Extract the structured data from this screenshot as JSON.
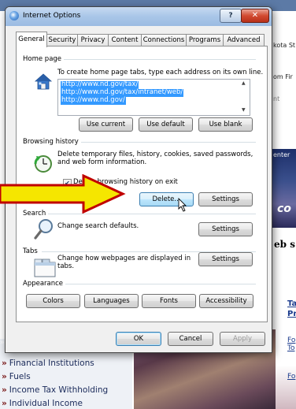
{
  "background": {
    "header_fragments": [
      "kota St",
      "om Fir",
      "nt"
    ],
    "banner_text": "enter",
    "banner_big": "co",
    "web_heading": "eb s",
    "links_right": [
      "Ta",
      "Pr",
      "Fo",
      "To",
      "Fo"
    ],
    "nav_items": [
      "Financial Institutions",
      "Fuels",
      "Income Tax Withholding",
      "Individual Income"
    ]
  },
  "dialog": {
    "title": "Internet Options",
    "help_label": "?",
    "close_label": "✕",
    "tabs": [
      "General",
      "Security",
      "Privacy",
      "Content",
      "Connections",
      "Programs",
      "Advanced"
    ],
    "home_page": {
      "label": "Home page",
      "description": "To create home page tabs, type each address on its own line.",
      "urls": [
        "http://www.nd.gov/tax/",
        "http://www.nd.gov/tax/intranet/web/",
        "http://www.nd.gov/"
      ],
      "buttons": {
        "use_current": "Use current",
        "use_default": "Use default",
        "use_blank": "Use blank"
      }
    },
    "browsing_history": {
      "label": "Browsing history",
      "description_line1": "Delete temporary files, history, cookies, saved passwords,",
      "description_line2": "and web form information.",
      "checkbox_label": "Delete browsing history on exit",
      "checkbox_checked": true,
      "delete_label": "Delete...",
      "settings_label": "Settings"
    },
    "search": {
      "label": "Search",
      "description": "Change search defaults.",
      "settings_label": "Settings"
    },
    "tabs_section": {
      "label": "Tabs",
      "description_line1": "Change how webpages are displayed in",
      "description_line2": "tabs.",
      "settings_label": "Settings"
    },
    "appearance": {
      "label": "Appearance",
      "buttons": {
        "colors": "Colors",
        "languages": "Languages",
        "fonts": "Fonts",
        "accessibility": "Accessibility"
      }
    },
    "footer": {
      "ok": "OK",
      "cancel": "Cancel",
      "apply": "Apply"
    }
  },
  "colors": {
    "accent_arrow": "#f5e600",
    "arrow_border": "#c00000",
    "selection": "#3399ff"
  }
}
